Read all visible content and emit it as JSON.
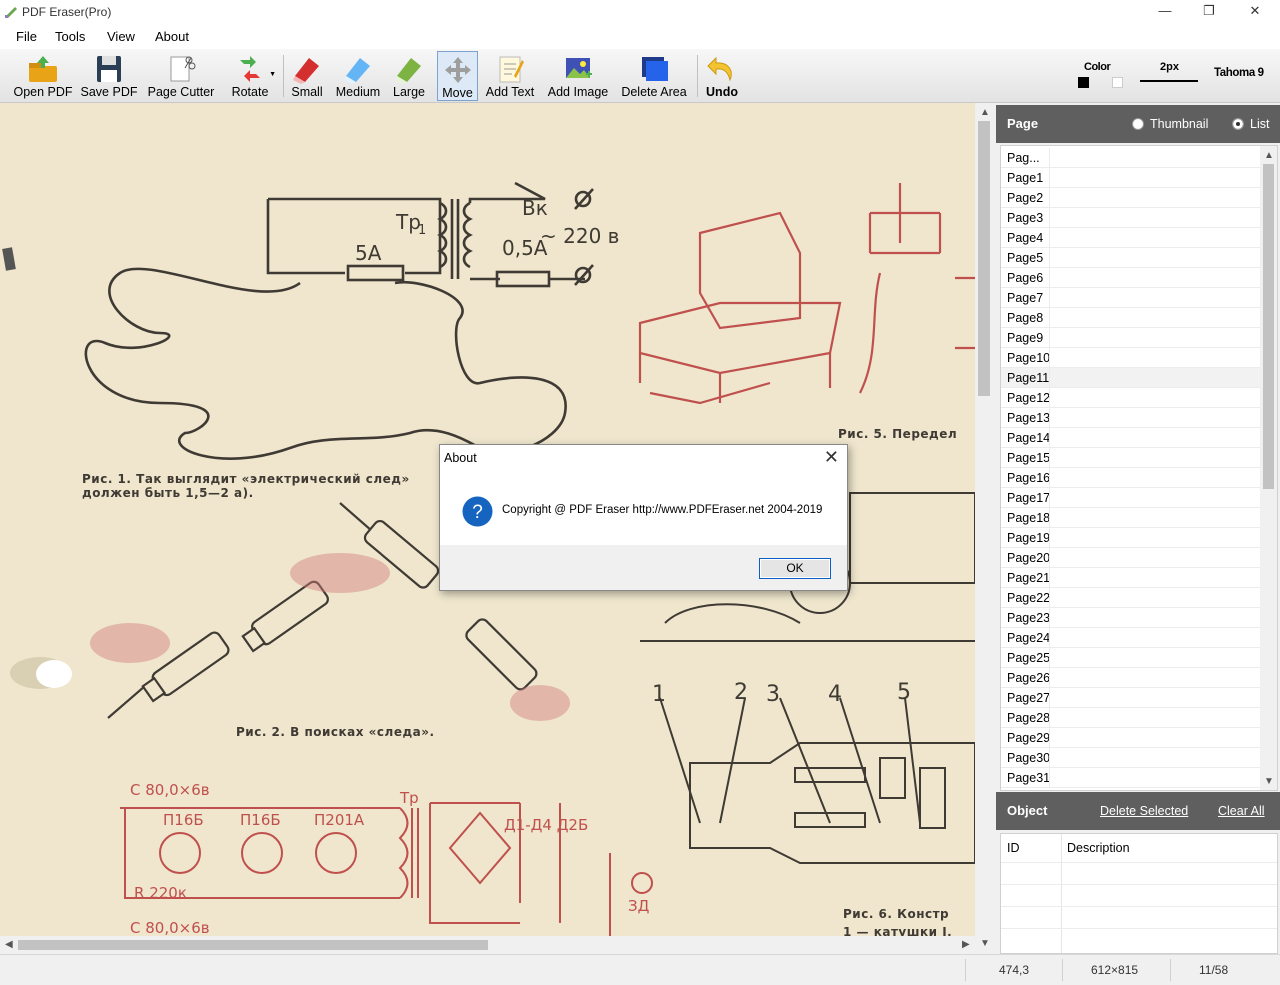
{
  "window": {
    "title": "PDF Eraser(Pro)",
    "minimize_glyph": "—",
    "restore_glyph": "❐",
    "close_glyph": "✕"
  },
  "menu": [
    "File",
    "Tools",
    "View",
    "About"
  ],
  "toolbar": {
    "open_pdf": "Open PDF",
    "save_pdf": "Save PDF",
    "page_cutter": "Page Cutter",
    "rotate": "Rotate",
    "small": "Small",
    "medium": "Medium",
    "large": "Large",
    "move": "Move",
    "add_text": "Add Text",
    "add_image": "Add Image",
    "delete_area": "Delete Area",
    "undo": "Undo",
    "color_label": "Color",
    "stroke_label": "2px",
    "font_label": "Tahoma 9",
    "active_tool": "Move"
  },
  "document": {
    "caption1a": "Рис. 1. Так выглядит «электрический след»",
    "caption1b": "должен быть 1,5—2 а).",
    "caption2": "Рис. 2. В поисках «следа».",
    "caption5": "Рис. 5. Передел",
    "caption6a": "Рис. 6. Констр",
    "caption6b": "1 — катушки I,",
    "label_tr": "Тр",
    "label_tr_sub": "1",
    "label_5a": "5А",
    "label_05a": "0,5А",
    "label_vk": "Вк",
    "label_220": "~ 220 в",
    "label_c1": "С 80,0×6в",
    "label_c2": "С 80,0×6в",
    "label_r": "R 220к",
    "label_p16b1": "П16Б",
    "label_p16b2": "П16Б",
    "label_p201": "П201А",
    "label_d": "Д1-Д4 Д2Б",
    "label_tr2": "Тр",
    "label_3d": "ЗД",
    "num_labels": [
      "1",
      "2",
      "3",
      "4",
      "5"
    ]
  },
  "page_panel": {
    "title": "Page",
    "options": [
      "Thumbnail",
      "List"
    ],
    "selected_option": "List",
    "header": "Pag...",
    "pages": [
      "Page1",
      "Page2",
      "Page3",
      "Page4",
      "Page5",
      "Page6",
      "Page7",
      "Page8",
      "Page9",
      "Page10",
      "Page11",
      "Page12",
      "Page13",
      "Page14",
      "Page15",
      "Page16",
      "Page17",
      "Page18",
      "Page19",
      "Page20",
      "Page21",
      "Page22",
      "Page23",
      "Page24",
      "Page25",
      "Page26",
      "Page27",
      "Page28",
      "Page29",
      "Page30",
      "Page31"
    ],
    "selected_page": "Page11"
  },
  "object_panel": {
    "title": "Object",
    "delete_selected": "Delete Selected",
    "clear_all": "Clear All",
    "columns": [
      "ID",
      "Description"
    ]
  },
  "status": {
    "cursor": "474,3",
    "page_size": "612×815",
    "page_index": "11/58"
  },
  "dialog": {
    "title": "About",
    "close_glyph": "✕",
    "message": "Copyright @ PDF Eraser http://www.PDFEraser.net 2004-2019",
    "icon_glyph": "?",
    "ok": "OK"
  },
  "colors": {
    "accent": "#0a5fc9",
    "panel_header": "#5f5f5f",
    "paper": "#efe6cd",
    "ink": "#3f3a33",
    "red_ink": "#c0504d"
  }
}
